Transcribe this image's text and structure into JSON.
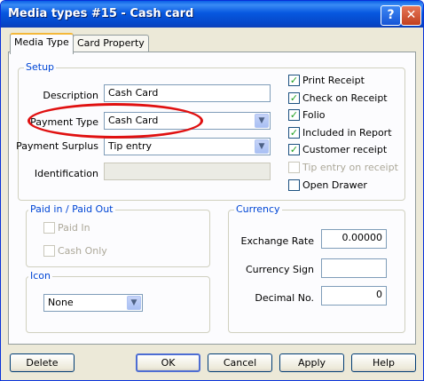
{
  "window": {
    "title": "Media types #15 - Cash card",
    "help_glyph": "?",
    "close_glyph": "✕"
  },
  "tabs": [
    {
      "label": "Media Type",
      "active": true
    },
    {
      "label": "Card Property",
      "active": false
    }
  ],
  "setup": {
    "legend": "Setup",
    "description_label": "Description",
    "description_value": "Cash Card",
    "payment_type_label": "Payment Type",
    "payment_type_value": "Cash Card",
    "payment_surplus_label": "Payment Surplus",
    "payment_surplus_value": "Tip entry",
    "identification_label": "Identification",
    "identification_value": ""
  },
  "options": [
    {
      "label": "Print Receipt",
      "checked": true,
      "enabled": true
    },
    {
      "label": "Check on Receipt",
      "checked": true,
      "enabled": true
    },
    {
      "label": "Folio",
      "checked": true,
      "enabled": true
    },
    {
      "label": "Included in Report",
      "checked": true,
      "enabled": true
    },
    {
      "label": "Customer receipt",
      "checked": true,
      "enabled": true
    },
    {
      "label": "Tip entry on receipt",
      "checked": false,
      "enabled": false
    },
    {
      "label": "Open Drawer",
      "checked": false,
      "enabled": true
    }
  ],
  "paid": {
    "legend": "Paid in / Paid Out",
    "items": [
      {
        "label": "Paid In",
        "checked": false,
        "enabled": false
      },
      {
        "label": "Cash Only",
        "checked": false,
        "enabled": false
      }
    ]
  },
  "icon": {
    "legend": "Icon",
    "value": "None"
  },
  "currency": {
    "legend": "Currency",
    "exchange_rate_label": "Exchange Rate",
    "exchange_rate_value": "0.00000",
    "currency_sign_label": "Currency Sign",
    "currency_sign_value": "",
    "decimal_label": "Decimal No.",
    "decimal_value": "0"
  },
  "buttons": {
    "delete": "Delete",
    "ok": "OK",
    "cancel": "Cancel",
    "apply": "Apply",
    "help": "Help"
  },
  "glyphs": {
    "dropdown": "▼",
    "check": "✓"
  },
  "colors": {
    "title_bar": "#0758e0",
    "group_legend": "#0046d5",
    "annotation": "#e01010",
    "check": "#21a121"
  }
}
